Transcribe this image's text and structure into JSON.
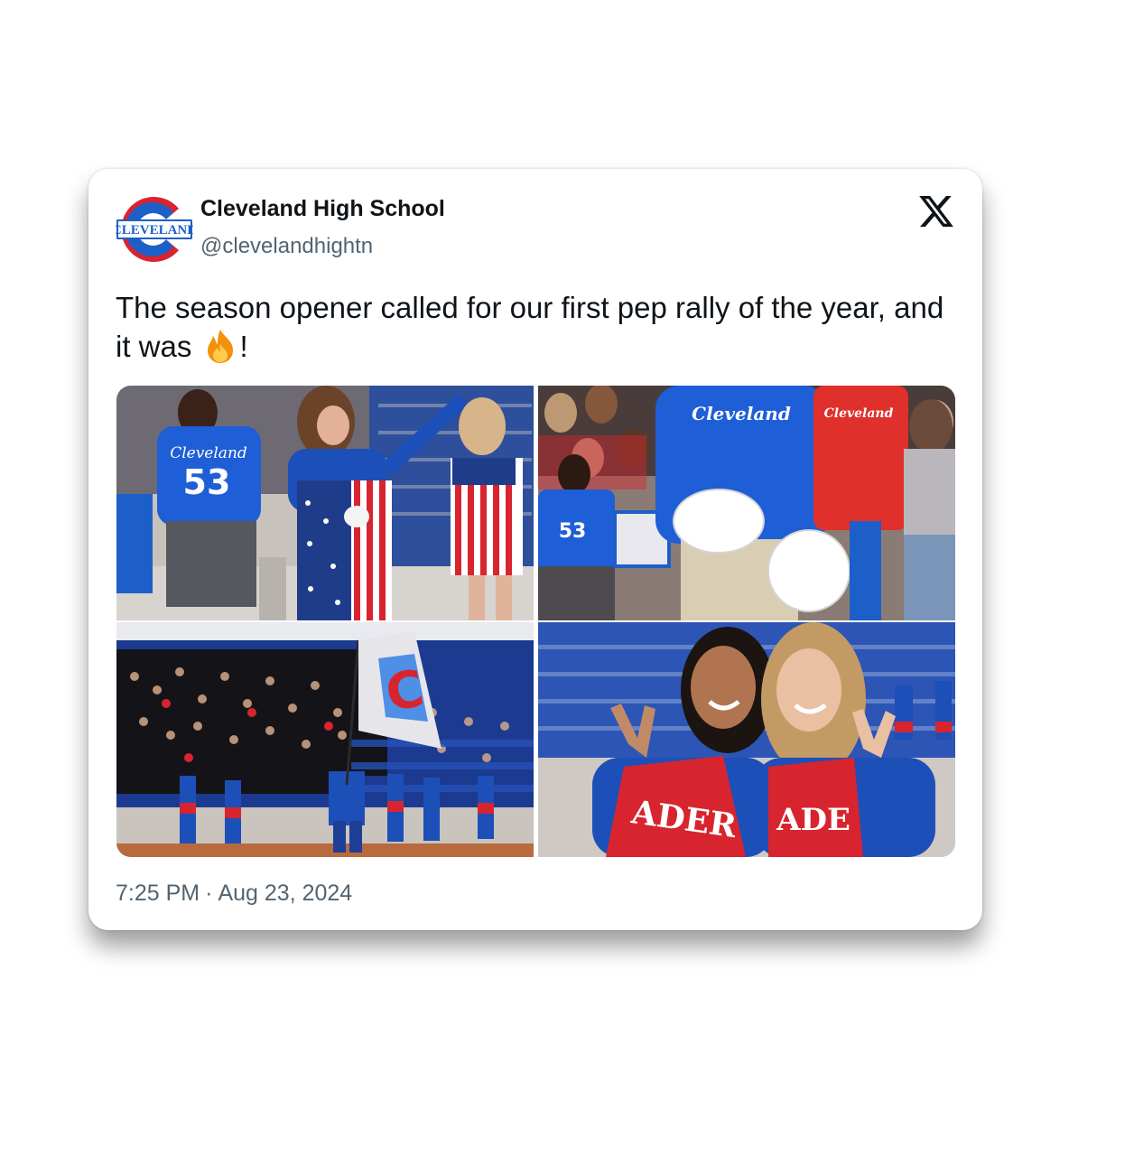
{
  "account": {
    "display_name": "Cleveland High School",
    "handle": "@clevelandhightn",
    "avatar_icon": "cleveland-c-logo-icon",
    "avatar_text": "CLEVELAND"
  },
  "platform_icon": "x-logo-icon",
  "tweet": {
    "text_before_emoji": "The season opener called for our first pep rally of the year, and it was ",
    "emoji": "fire-emoji-icon",
    "text_after_emoji": "!"
  },
  "media": {
    "photos": [
      {
        "name": "photo-singer-flag-overalls",
        "jersey_text": "Cleveland",
        "jersey_number": "53"
      },
      {
        "name": "photo-pompoms-crowd",
        "shirt_text_1": "Cleveland",
        "shirt_text_2": "Cleveland",
        "jersey_number": "53"
      },
      {
        "name": "photo-flag-bleachers",
        "flag_letter": "C"
      },
      {
        "name": "photo-two-cheerleaders"
      }
    ]
  },
  "meta": {
    "time": "7:25 PM",
    "separator": "·",
    "date": "Aug 23, 2024"
  },
  "colors": {
    "brand_blue": "#1d5fc9",
    "brand_red": "#d8242f",
    "text_primary": "#0f1419",
    "text_secondary": "#536471"
  }
}
